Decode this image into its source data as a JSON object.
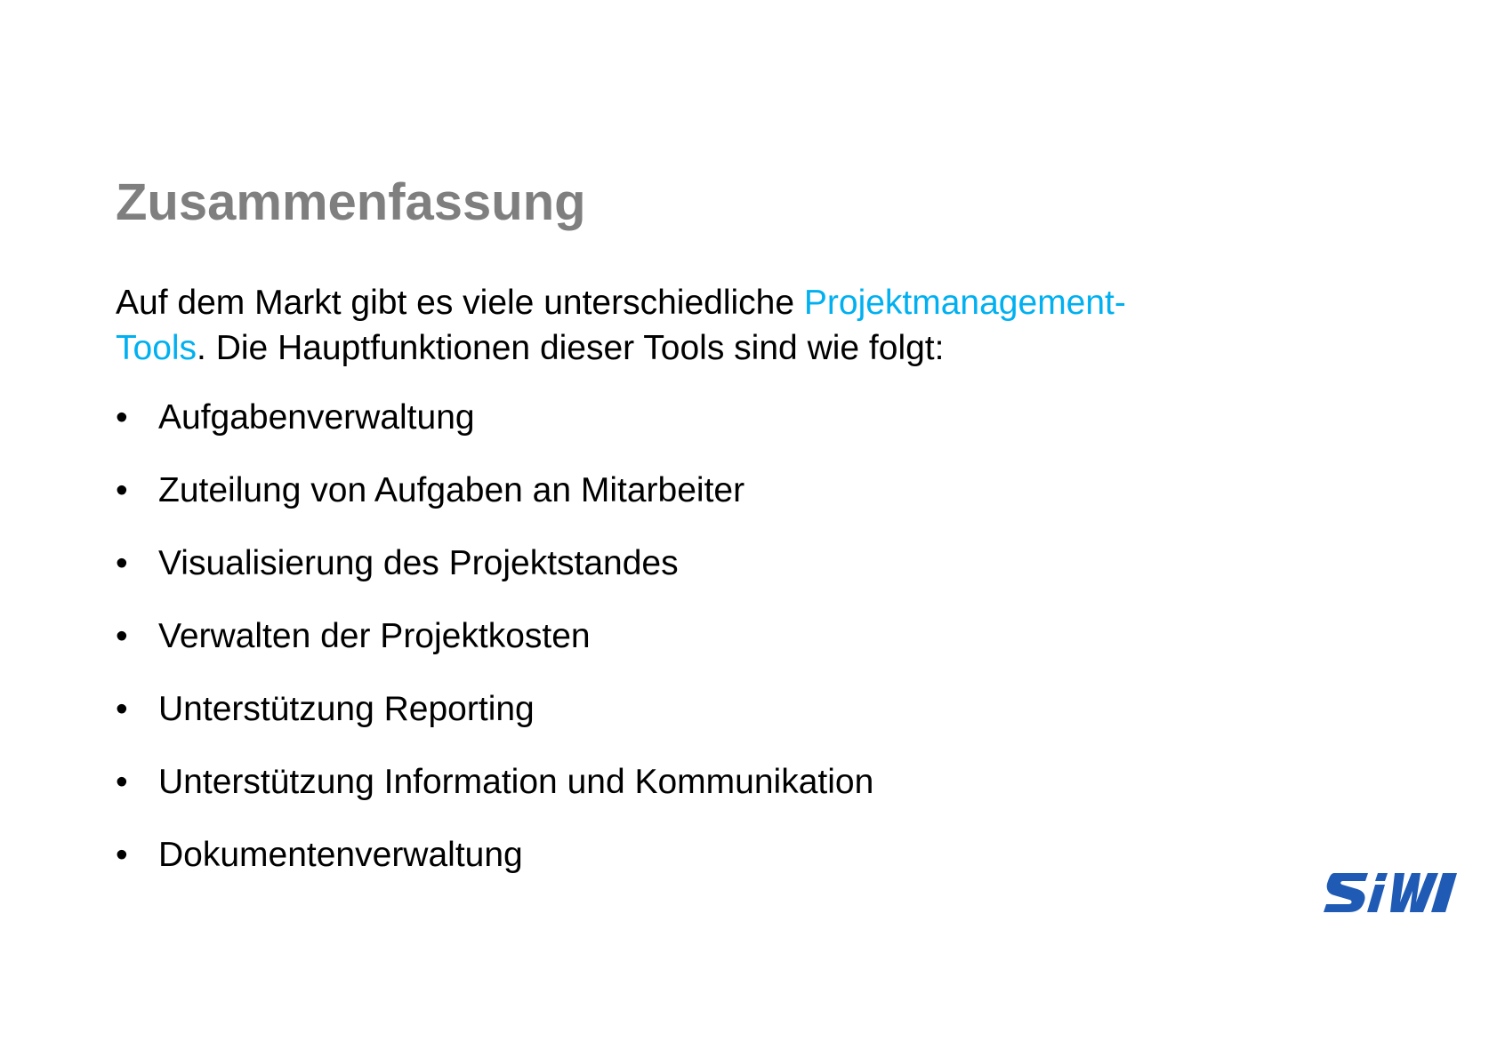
{
  "slide": {
    "title": "Zusammenfassung",
    "intro": {
      "line1_prefix": "Auf dem Markt gibt es viele unterschiedliche ",
      "line1_link": "Projektmanagement-",
      "line2_link": "Tools",
      "line2_suffix": ". Die Hauptfunktionen dieser Tools sind wie folgt:",
      "link_color": "#00b0f0"
    },
    "bullet_symbol": "•",
    "bullets": [
      "Aufgabenverwaltung",
      "Zuteilung von Aufgaben an Mitarbeiter",
      "Visualisierung des Projektstandes",
      "Verwalten der Projektkosten",
      "Unterstützung Reporting",
      "Unterstützung Information und Kommunikation",
      "Dokumentenverwaltung"
    ],
    "title_color": "#7f7f7f",
    "logo": {
      "text": "SIW",
      "color": "#1f5bb5"
    }
  }
}
